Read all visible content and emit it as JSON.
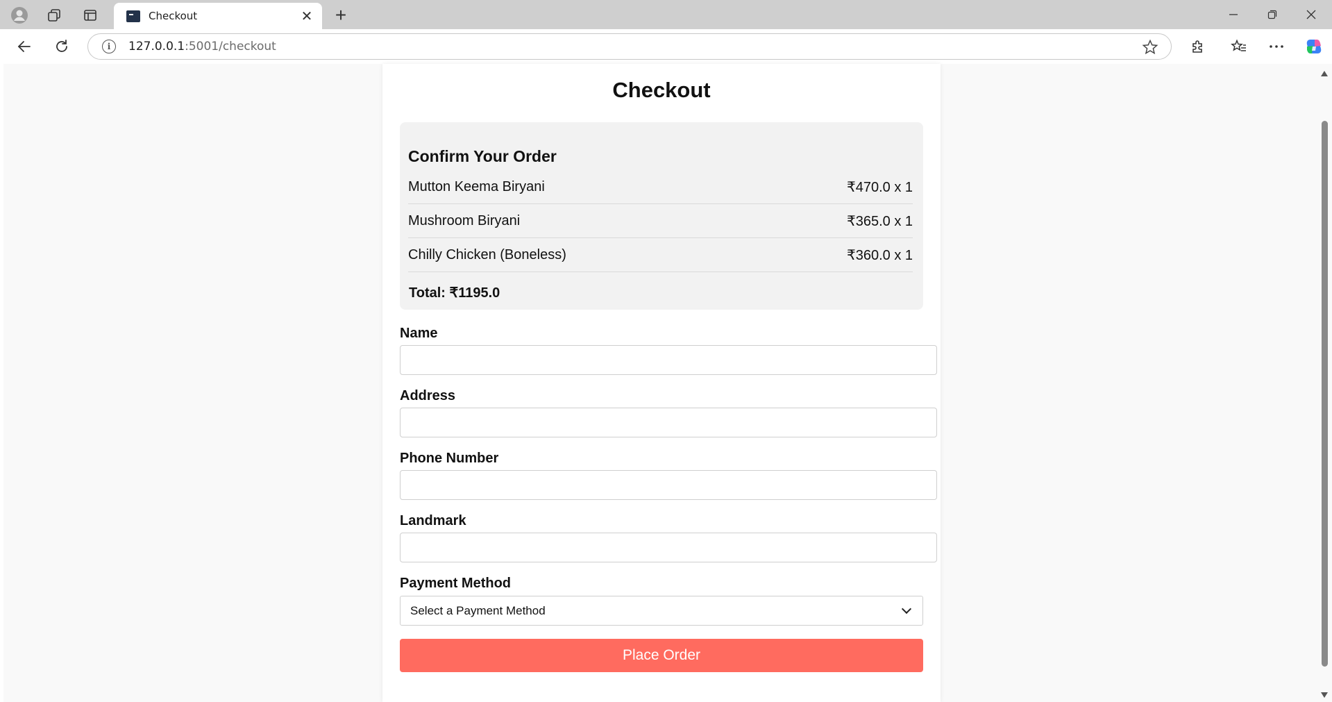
{
  "browser": {
    "tab_title": "Checkout",
    "url_host": "127.0.0.1",
    "url_rest": ":5001/checkout"
  },
  "page": {
    "title": "Checkout",
    "summary": {
      "heading": "Confirm Your Order",
      "items": [
        {
          "name": "Mutton Keema Biryani",
          "price": "₹470.0 x 1"
        },
        {
          "name": "Mushroom Biryani",
          "price": "₹365.0 x 1"
        },
        {
          "name": "Chilly Chicken (Boneless)",
          "price": "₹360.0 x 1"
        }
      ],
      "total": "Total: ₹1195.0"
    },
    "form": {
      "name_label": "Name",
      "name_value": "",
      "address_label": "Address",
      "address_value": "",
      "phone_label": "Phone Number",
      "phone_value": "",
      "landmark_label": "Landmark",
      "landmark_value": "",
      "payment_label": "Payment Method",
      "payment_selected": "Select a Payment Method",
      "submit_label": "Place Order"
    }
  },
  "colors": {
    "accent": "#ff6b5f",
    "summary_bg": "#f2f2f2",
    "page_bg": "#f9f9f9"
  }
}
